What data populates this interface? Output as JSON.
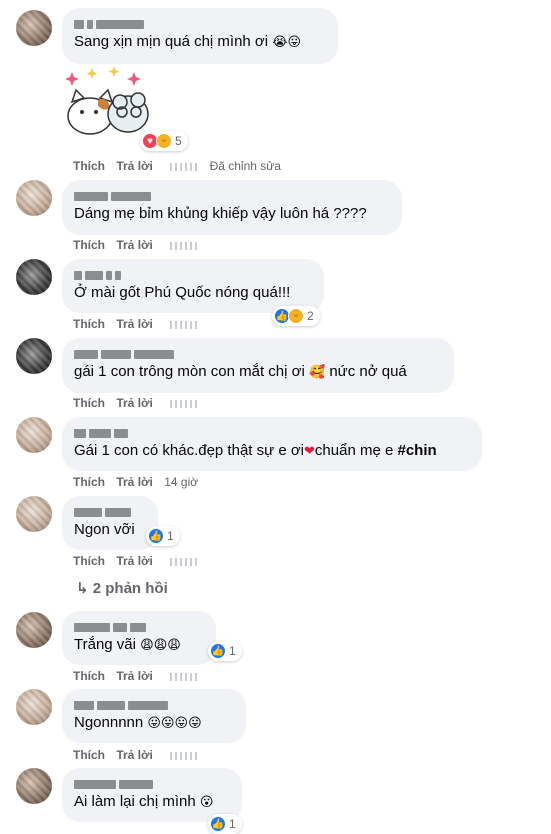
{
  "actions": {
    "like": "Thích",
    "reply": "Trả lời"
  },
  "comments": [
    {
      "text": "Sang xịn mịn quá chị mình ơi",
      "emoji": "😭😛",
      "edited": "Đã chỉnh sửa",
      "reactions": {
        "types": [
          "love-icon",
          "haha-icon"
        ],
        "count": "5"
      }
    },
    {
      "text": "Dáng mẹ bỉm khủng khiếp vậy luôn há ????"
    },
    {
      "text": "Ở mài gốt Phú Quốc nóng quá!!!",
      "reactions": {
        "types": [
          "like-icon",
          "haha-icon"
        ],
        "count": "2"
      }
    },
    {
      "text": "gái 1 con trông mòn con mắt chị ơi",
      "emoji": "🥰",
      "text2": "nức nở quá"
    },
    {
      "text": "Gái 1 con có khác.đẹp thật sự e ơi",
      "emoji": "❤",
      "text2": "chuẩn mẹ e",
      "hashtag": "#chin",
      "time": "14 giờ"
    },
    {
      "text": "Ngon vỡi",
      "reactions": {
        "types": [
          "like-icon"
        ],
        "count": "1"
      },
      "replies": "2 phản hồi"
    },
    {
      "text": "Trắng vãi",
      "emoji": "😩😩😩",
      "reactions": {
        "types": [
          "like-icon"
        ],
        "count": "1"
      }
    },
    {
      "text": "Ngonnnnn",
      "emoji": "😛😛😛😛"
    },
    {
      "text": "Ai làm lại chị mình",
      "emoji": "😮",
      "reactions": {
        "types": [
          "like-icon"
        ],
        "count": "1"
      }
    }
  ]
}
